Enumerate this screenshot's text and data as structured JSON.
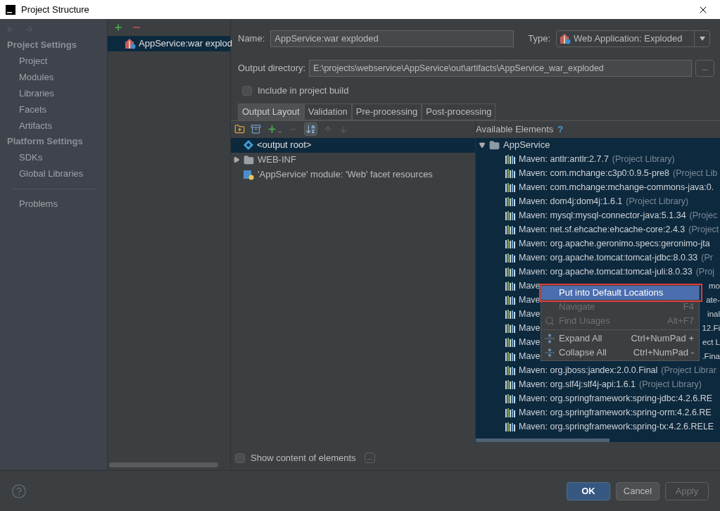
{
  "window": {
    "title": "Project Structure"
  },
  "sidebar": {
    "sections": [
      {
        "heading": "Project Settings",
        "items": [
          {
            "label": "Project",
            "selected": false
          },
          {
            "label": "Modules",
            "selected": false
          },
          {
            "label": "Libraries",
            "selected": false
          },
          {
            "label": "Facets",
            "selected": false
          },
          {
            "label": "Artifacts",
            "selected": false
          }
        ]
      },
      {
        "heading": "Platform Settings",
        "items": [
          {
            "label": "SDKs",
            "selected": false
          },
          {
            "label": "Global Libraries",
            "selected": false
          }
        ]
      }
    ],
    "extra_items": [
      {
        "label": "Problems",
        "selected": false
      }
    ]
  },
  "artifacts": [
    {
      "label": "AppService:war explod",
      "selected": true
    }
  ],
  "name_field": {
    "label": "Name:",
    "value": "AppService:war exploded"
  },
  "type_field": {
    "label": "Type:",
    "value": "Web Application: Exploded"
  },
  "output_directory": {
    "label": "Output directory:",
    "value": "E:\\projects\\webservice\\AppService\\out\\artifacts\\AppService_war_exploded",
    "browse": "..."
  },
  "include_in_build": {
    "label": "Include in project build",
    "checked": false
  },
  "tabs": [
    {
      "label": "Output Layout",
      "selected": true
    },
    {
      "label": "Validation",
      "selected": false
    },
    {
      "label": "Pre-processing",
      "selected": false
    },
    {
      "label": "Post-processing",
      "selected": false
    }
  ],
  "output_tree": [
    {
      "label": "<output root>",
      "kind": "root",
      "selected": true
    },
    {
      "label": "WEB-INF",
      "kind": "folder",
      "expanded": false,
      "selected": false
    },
    {
      "label": "'AppService' module: 'Web' facet resources",
      "kind": "facet",
      "selected": false
    }
  ],
  "available_elements": {
    "title": "Available Elements",
    "help": "?",
    "module": {
      "label": "AppService",
      "expanded": true,
      "children": [
        {
          "text": "Maven: antlr:antlr:2.7.7",
          "suffix": "(Project Library)"
        },
        {
          "text": "Maven: com.mchange:c3p0:0.9.5-pre8",
          "suffix": "(Project Lib"
        },
        {
          "text": "Maven: com.mchange:mchange-commons-java:0."
        },
        {
          "text": "Maven: dom4j:dom4j:1.6.1",
          "suffix": "(Project Library)"
        },
        {
          "text": "Maven: mysql:mysql-connector-java:5.1.34",
          "suffix": "(Projec"
        },
        {
          "text": "Maven: net.sf.ehcache:ehcache-core:2.4.3",
          "suffix": "(Project"
        },
        {
          "text": "Maven: org.apache.geronimo.specs:geronimo-jta"
        },
        {
          "text": "Maven: org.apache.tomcat:tomcat-jdbc:8.0.33",
          "suffix": "(Pr"
        },
        {
          "text": "Maven: org.apache.tomcat:tomcat-juli:8.0.33",
          "suffix": "(Proj"
        },
        {
          "text": "Mave",
          "tail": "mo"
        },
        {
          "text": "Mave",
          "tail": "ate-"
        },
        {
          "text": "Mave",
          "tail": "inal"
        },
        {
          "text": "Mave",
          "tail": "12.Fi"
        },
        {
          "text": "Mave",
          "tail": "ect L"
        },
        {
          "text": "Mave",
          "tail": ".Fina"
        },
        {
          "text": "Maven: org.jboss:jandex:2.0.0.Final",
          "suffix": "(Project Librar"
        },
        {
          "text": "Maven: org.slf4j:slf4j-api:1.6.1",
          "suffix": "(Project Library)"
        },
        {
          "text": "Maven: org.springframework:spring-jdbc:4.2.6.RE"
        },
        {
          "text": "Maven: org.springframework:spring-orm:4.2.6.RE"
        },
        {
          "text": "Maven: org.springframework:spring-tx:4.2.6.RELE"
        }
      ]
    }
  },
  "context_menu": [
    {
      "label": "Put into Default Locations",
      "kind": "plain",
      "selected": true,
      "disabled": false
    },
    {
      "label": "Navigate",
      "shortcut": "F4",
      "kind": "plain",
      "selected": false,
      "disabled": true
    },
    {
      "label": "Find Usages",
      "shortcut": "Alt+F7",
      "kind": "search",
      "selected": false,
      "disabled": true
    },
    {
      "label": "Expand All",
      "shortcut": "Ctrl+NumPad +",
      "kind": "expand",
      "selected": false,
      "disabled": false
    },
    {
      "label": "Collapse All",
      "shortcut": "Ctrl+NumPad -",
      "kind": "collapse",
      "selected": false,
      "disabled": false
    }
  ],
  "show_content": {
    "label": "Show content of elements",
    "checked": false,
    "browse": "..."
  },
  "buttons": [
    {
      "label": "OK",
      "kind": "primary",
      "disabled": false
    },
    {
      "label": "Cancel",
      "kind": "normal",
      "disabled": false
    },
    {
      "label": "Apply",
      "kind": "normal",
      "disabled": true
    }
  ]
}
